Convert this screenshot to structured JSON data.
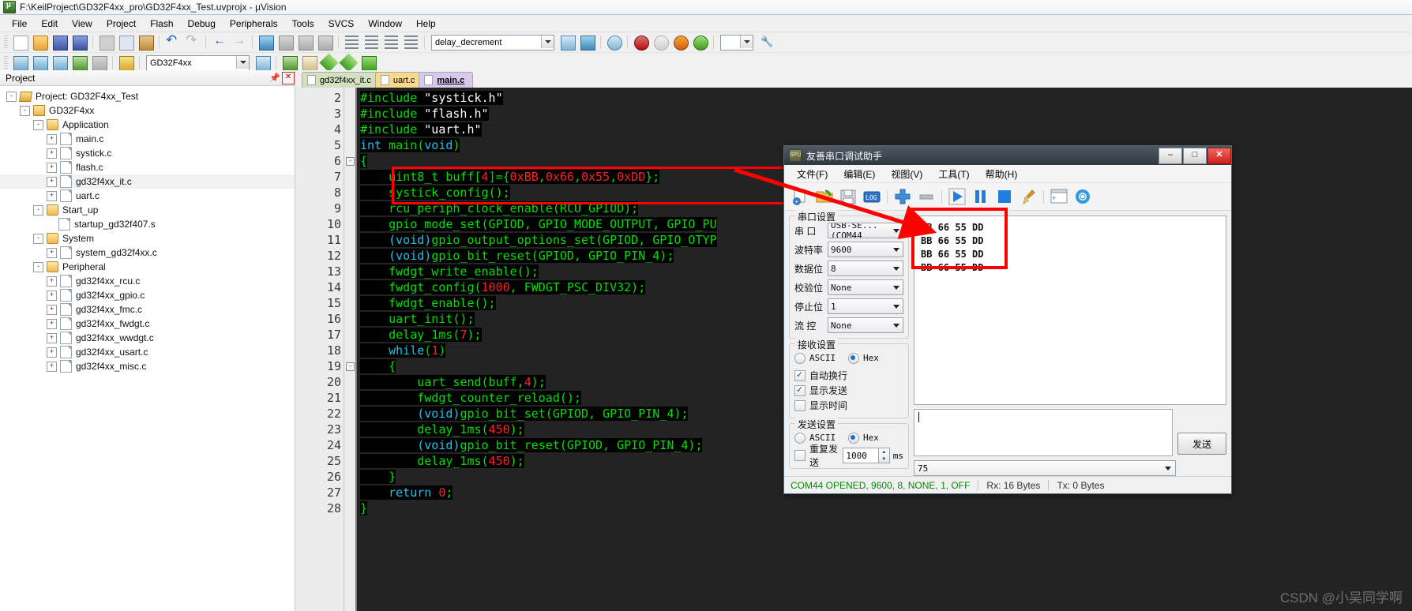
{
  "window": {
    "title": "F:\\KeilProject\\GD32F4xx_pro\\GD32F4xx_Test.uvprojx - µVision",
    "icon": "keil-uvision-icon"
  },
  "menubar": [
    "File",
    "Edit",
    "View",
    "Project",
    "Flash",
    "Debug",
    "Peripherals",
    "Tools",
    "SVCS",
    "Window",
    "Help"
  ],
  "toolbar": {
    "target_combo_value": "delay_decrement",
    "target_select_value": "GD32F4xx",
    "icons_row1": [
      "new-file-icon",
      "open-file-icon",
      "save-icon",
      "save-all-icon",
      "cut-icon",
      "copy-icon",
      "paste-icon",
      "undo-icon",
      "redo-icon",
      "back-icon",
      "forward-icon",
      "bookmark-toggle-icon",
      "bookmark-prev-icon",
      "bookmark-next-icon",
      "bookmark-clear-icon",
      "indent-icon",
      "outdent-icon",
      "comment-icon",
      "uncomment-icon",
      "find-icon",
      "debug-start-icon",
      "insert-bookmark-icon",
      "reset-icon",
      "analysis-icon",
      "config-wizard-icon"
    ],
    "icons_row2": [
      "translate-icon",
      "build-icon",
      "rebuild-icon",
      "batch-build-icon",
      "stop-build-icon",
      "load-icon",
      "magic-wand-icon",
      "target-options-icon",
      "manage-project-icon",
      "green-diamond-icon",
      "green-diamond2-icon",
      "books-icon"
    ]
  },
  "project_pane": {
    "header": "Project",
    "pin_icon": "pin-icon",
    "close_icon": "close-icon",
    "tree": [
      {
        "label": "Project: GD32F4xx_Test",
        "indent": 0,
        "expander": "-",
        "icon": "project-icon",
        "selected": false
      },
      {
        "label": "GD32F4xx",
        "indent": 1,
        "expander": "-",
        "icon": "target-icon",
        "selected": false
      },
      {
        "label": "Application",
        "indent": 2,
        "expander": "-",
        "icon": "folder-icon",
        "selected": false
      },
      {
        "label": "main.c",
        "indent": 3,
        "expander": "+",
        "icon": "file-icon",
        "selected": false
      },
      {
        "label": "systick.c",
        "indent": 3,
        "expander": "+",
        "icon": "file-icon",
        "selected": false
      },
      {
        "label": "flash.c",
        "indent": 3,
        "expander": "+",
        "icon": "file-icon",
        "selected": false
      },
      {
        "label": "gd32f4xx_it.c",
        "indent": 3,
        "expander": "+",
        "icon": "file-icon",
        "selected": true
      },
      {
        "label": "uart.c",
        "indent": 3,
        "expander": "+",
        "icon": "file-icon",
        "selected": false
      },
      {
        "label": "Start_up",
        "indent": 2,
        "expander": "-",
        "icon": "folder-icon",
        "selected": false
      },
      {
        "label": "startup_gd32f407.s",
        "indent": 3,
        "expander": "",
        "icon": "file-icon",
        "selected": false
      },
      {
        "label": "System",
        "indent": 2,
        "expander": "-",
        "icon": "folder-icon",
        "selected": false
      },
      {
        "label": "system_gd32f4xx.c",
        "indent": 3,
        "expander": "+",
        "icon": "file-icon",
        "selected": false
      },
      {
        "label": "Peripheral",
        "indent": 2,
        "expander": "-",
        "icon": "folder-icon",
        "selected": false
      },
      {
        "label": "gd32f4xx_rcu.c",
        "indent": 3,
        "expander": "+",
        "icon": "file-icon",
        "selected": false
      },
      {
        "label": "gd32f4xx_gpio.c",
        "indent": 3,
        "expander": "+",
        "icon": "file-icon",
        "selected": false
      },
      {
        "label": "gd32f4xx_fmc.c",
        "indent": 3,
        "expander": "+",
        "icon": "file-icon",
        "selected": false
      },
      {
        "label": "gd32f4xx_fwdgt.c",
        "indent": 3,
        "expander": "+",
        "icon": "file-icon",
        "selected": false
      },
      {
        "label": "gd32f4xx_wwdgt.c",
        "indent": 3,
        "expander": "+",
        "icon": "file-icon",
        "selected": false
      },
      {
        "label": "gd32f4xx_usart.c",
        "indent": 3,
        "expander": "+",
        "icon": "file-icon",
        "selected": false
      },
      {
        "label": "gd32f4xx_misc.c",
        "indent": 3,
        "expander": "+",
        "icon": "file-icon",
        "selected": false
      }
    ]
  },
  "editor": {
    "tabs": [
      {
        "label": "gd32f4xx_it.c",
        "active": false
      },
      {
        "label": "uart.c",
        "active": false
      },
      {
        "label": "main.c",
        "active": true
      }
    ],
    "first_line_number": 2,
    "lines": [
      {
        "n": 2,
        "fold": "",
        "tokens": [
          {
            "t": "#include",
            "c": "g"
          },
          {
            "t": " ",
            "c": "w"
          },
          {
            "t": "\"systick.h\"",
            "c": "w"
          }
        ]
      },
      {
        "n": 3,
        "fold": "",
        "tokens": [
          {
            "t": "#include",
            "c": "g"
          },
          {
            "t": " ",
            "c": "w"
          },
          {
            "t": "\"flash.h\"",
            "c": "w"
          }
        ]
      },
      {
        "n": 4,
        "fold": "",
        "tokens": [
          {
            "t": "#include",
            "c": "g"
          },
          {
            "t": " ",
            "c": "w"
          },
          {
            "t": "\"uart.h\"",
            "c": "w"
          }
        ]
      },
      {
        "n": 5,
        "fold": "",
        "tokens": [
          {
            "t": "int",
            "c": "b"
          },
          {
            "t": " ",
            "c": "w"
          },
          {
            "t": "main",
            "c": "g"
          },
          {
            "t": "(",
            "c": "g"
          },
          {
            "t": "void",
            "c": "b"
          },
          {
            "t": ")",
            "c": "g"
          }
        ]
      },
      {
        "n": 6,
        "fold": "-",
        "tokens": [
          {
            "t": "{",
            "c": "g"
          }
        ]
      },
      {
        "n": 7,
        "fold": "",
        "tokens": [
          {
            "t": "    ",
            "c": "w"
          },
          {
            "t": "uint8_t",
            "c": "g"
          },
          {
            "t": " buff",
            "c": "g"
          },
          {
            "t": "[",
            "c": "g"
          },
          {
            "t": "4",
            "c": "r"
          },
          {
            "t": "]={",
            "c": "g"
          },
          {
            "t": "0xBB",
            "c": "r"
          },
          {
            "t": ",",
            "c": "g"
          },
          {
            "t": "0x66",
            "c": "r"
          },
          {
            "t": ",",
            "c": "g"
          },
          {
            "t": "0x55",
            "c": "r"
          },
          {
            "t": ",",
            "c": "g"
          },
          {
            "t": "0xDD",
            "c": "r"
          },
          {
            "t": "};",
            "c": "g"
          }
        ]
      },
      {
        "n": 8,
        "fold": "",
        "tokens": [
          {
            "t": "    systick_config();",
            "c": "g"
          }
        ]
      },
      {
        "n": 9,
        "fold": "",
        "tokens": [
          {
            "t": "    rcu_periph_clock_enable(RCU_GPIOD);",
            "c": "g"
          }
        ]
      },
      {
        "n": 10,
        "fold": "",
        "tokens": [
          {
            "t": "    gpio_mode_set(GPIOD, GPIO_MODE_OUTPUT, GPIO_PU",
            "c": "g"
          }
        ]
      },
      {
        "n": 11,
        "fold": "",
        "tokens": [
          {
            "t": "    (",
            "c": "b"
          },
          {
            "t": "void",
            "c": "b"
          },
          {
            "t": ")",
            "c": "b"
          },
          {
            "t": "gpio_output_options_set(GPIOD, GPIO_OTYP",
            "c": "g"
          }
        ]
      },
      {
        "n": 12,
        "fold": "",
        "tokens": [
          {
            "t": "    (",
            "c": "b"
          },
          {
            "t": "void",
            "c": "b"
          },
          {
            "t": ")",
            "c": "b"
          },
          {
            "t": "gpio_bit_reset(GPIOD, GPIO_PIN_4);",
            "c": "g"
          }
        ]
      },
      {
        "n": 13,
        "fold": "",
        "tokens": [
          {
            "t": "    fwdgt_write_enable();",
            "c": "g"
          }
        ]
      },
      {
        "n": 14,
        "fold": "",
        "tokens": [
          {
            "t": "    fwdgt_config(",
            "c": "g"
          },
          {
            "t": "1000",
            "c": "r"
          },
          {
            "t": ", FWDGT_PSC_DIV32);",
            "c": "g"
          }
        ]
      },
      {
        "n": 15,
        "fold": "",
        "tokens": [
          {
            "t": "    fwdgt_enable();",
            "c": "g"
          }
        ]
      },
      {
        "n": 16,
        "fold": "",
        "tokens": [
          {
            "t": "    uart_init();",
            "c": "g"
          }
        ]
      },
      {
        "n": 17,
        "fold": "",
        "tokens": [
          {
            "t": "    delay_1ms(",
            "c": "g"
          },
          {
            "t": "7",
            "c": "r"
          },
          {
            "t": ");",
            "c": "g"
          }
        ]
      },
      {
        "n": 18,
        "fold": "",
        "tokens": [
          {
            "t": "    ",
            "c": "w"
          },
          {
            "t": "while",
            "c": "b"
          },
          {
            "t": "(",
            "c": "g"
          },
          {
            "t": "1",
            "c": "r"
          },
          {
            "t": ")",
            "c": "g"
          }
        ]
      },
      {
        "n": 19,
        "fold": "-",
        "tokens": [
          {
            "t": "    {",
            "c": "g"
          }
        ]
      },
      {
        "n": 20,
        "fold": "",
        "tokens": [
          {
            "t": "        uart_send(buff,",
            "c": "g"
          },
          {
            "t": "4",
            "c": "r"
          },
          {
            "t": ");",
            "c": "g"
          }
        ]
      },
      {
        "n": 21,
        "fold": "",
        "tokens": [
          {
            "t": "        fwdgt_counter_reload();",
            "c": "g"
          }
        ]
      },
      {
        "n": 22,
        "fold": "",
        "tokens": [
          {
            "t": "        (",
            "c": "b"
          },
          {
            "t": "void",
            "c": "b"
          },
          {
            "t": ")",
            "c": "b"
          },
          {
            "t": "gpio_bit_set(GPIOD, GPIO_PIN_4);",
            "c": "g"
          }
        ]
      },
      {
        "n": 23,
        "fold": "",
        "tokens": [
          {
            "t": "        delay_1ms(",
            "c": "g"
          },
          {
            "t": "450",
            "c": "r"
          },
          {
            "t": ");",
            "c": "g"
          }
        ]
      },
      {
        "n": 24,
        "fold": "",
        "tokens": [
          {
            "t": "        (",
            "c": "b"
          },
          {
            "t": "void",
            "c": "b"
          },
          {
            "t": ")",
            "c": "b"
          },
          {
            "t": "gpio_bit_reset(GPIOD, GPIO_PIN_4);",
            "c": "g"
          }
        ]
      },
      {
        "n": 25,
        "fold": "",
        "tokens": [
          {
            "t": "        delay_1ms(",
            "c": "g"
          },
          {
            "t": "450",
            "c": "r"
          },
          {
            "t": ");",
            "c": "g"
          }
        ]
      },
      {
        "n": 26,
        "fold": "",
        "tokens": [
          {
            "t": "    }",
            "c": "g"
          }
        ]
      },
      {
        "n": 27,
        "fold": "",
        "tokens": [
          {
            "t": "    ",
            "c": "w"
          },
          {
            "t": "return",
            "c": "b"
          },
          {
            "t": " ",
            "c": "w"
          },
          {
            "t": "0",
            "c": "r"
          },
          {
            "t": ";",
            "c": "g"
          }
        ]
      },
      {
        "n": 28,
        "fold": "",
        "tokens": [
          {
            "t": "}",
            "c": "g"
          }
        ]
      }
    ],
    "highlight_color": "#ff0000"
  },
  "serial": {
    "title": "友善串口调试助手",
    "window_icon": "serial-app-icon",
    "window_buttons": {
      "minimize": "–",
      "maximize": "□",
      "close": "✕"
    },
    "menu": [
      "文件(F)",
      "编辑(E)",
      "视图(V)",
      "工具(T)",
      "帮助(H)"
    ],
    "toolbar_icons": [
      "new-session-icon",
      "open-folder-icon",
      "save-icon",
      "log-icon",
      "add-icon",
      "remove-icon",
      "play-icon",
      "pause-icon",
      "stop-icon",
      "clear-broom-icon",
      "new-window-icon",
      "settings-gear-icon"
    ],
    "port_settings": {
      "caption": "串口设置",
      "rows": [
        {
          "label": "串  口",
          "value": "USB-SE... (COM44"
        },
        {
          "label": "波特率",
          "value": "9600"
        },
        {
          "label": "数据位",
          "value": "8"
        },
        {
          "label": "校验位",
          "value": "None"
        },
        {
          "label": "停止位",
          "value": "1"
        },
        {
          "label": "流  控",
          "value": "None"
        }
      ]
    },
    "recv_settings": {
      "caption": "接收设置",
      "ascii_label": "ASCII",
      "hex_label": "Hex",
      "mode": "Hex",
      "checks": [
        {
          "label": "自动换行",
          "checked": true
        },
        {
          "label": "显示发送",
          "checked": true
        },
        {
          "label": "显示时间",
          "checked": false
        }
      ]
    },
    "send_settings": {
      "caption": "发送设置",
      "ascii_label": "ASCII",
      "hex_label": "Hex",
      "mode": "Hex",
      "repeat_label": "重复发送",
      "repeat_checked": false,
      "interval_value": "1000",
      "interval_unit": "ms"
    },
    "receive_area": {
      "lines": [
        "BB 66 55 DD",
        "BB 66 55 DD",
        "BB 66 55 DD",
        "BB 66 55 DD"
      ],
      "highlight_color": "#ff0000"
    },
    "send_area": {
      "value": "",
      "placeholder": ""
    },
    "send_button": "发送",
    "history_value": "75",
    "status": {
      "connection": "COM44 OPENED, 9600, 8, NONE, 1, OFF",
      "rx": "Rx: 16 Bytes",
      "tx": "Tx: 0 Bytes"
    }
  },
  "watermark": "CSDN @小吴同学啊"
}
